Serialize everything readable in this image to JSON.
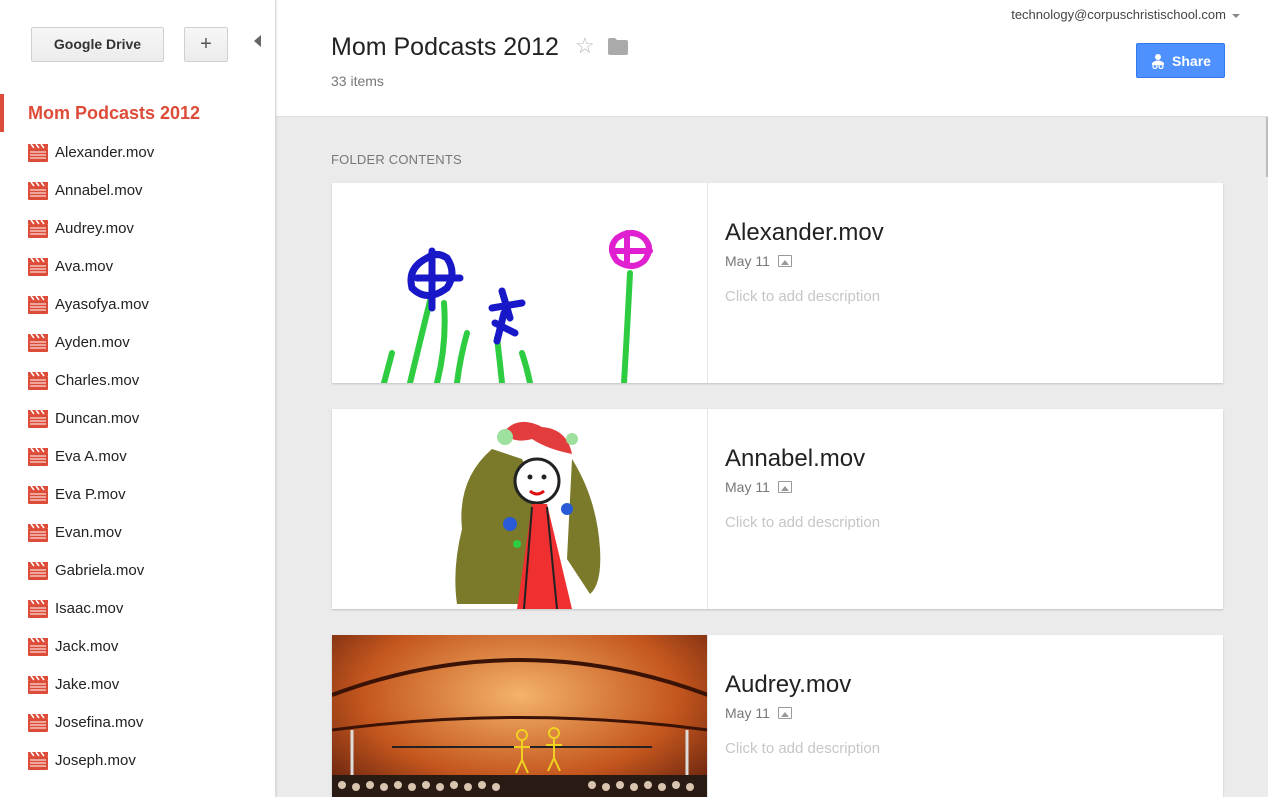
{
  "sidebar": {
    "drive_button": "Google Drive",
    "new_button": "+",
    "current_folder": "Mom Podcasts 2012",
    "files": [
      "Alexander.mov",
      "Annabel.mov",
      "Audrey.mov",
      "Ava.mov",
      "Ayasofya.mov",
      "Ayden.mov",
      "Charles.mov",
      "Duncan.mov",
      "Eva A.mov",
      "Eva P.mov",
      "Evan.mov",
      "Gabriela.mov",
      "Isaac.mov",
      "Jack.mov",
      "Jake.mov",
      "Josefina.mov",
      "Joseph.mov"
    ]
  },
  "header": {
    "title": "Mom Podcasts 2012",
    "item_count": "33 items",
    "account": "technology@corpuschristischool.com",
    "share_label": "Share"
  },
  "main": {
    "section_label": "FOLDER CONTENTS",
    "cards": [
      {
        "title": "Alexander.mov",
        "date": "May 11",
        "description": "Click to add description",
        "thumb": "flowers-drawing"
      },
      {
        "title": "Annabel.mov",
        "date": "May 11",
        "description": "Click to add description",
        "thumb": "portrait-drawing"
      },
      {
        "title": "Audrey.mov",
        "date": "May 11",
        "description": "Click to add description",
        "thumb": "circus-drawing"
      }
    ]
  },
  "colors": {
    "accent_red": "#dd4b39",
    "share_blue": "#4d90fe",
    "background": "#ebebeb"
  },
  "icons": {
    "file": "video-clapper-icon",
    "star": "star-outline-icon",
    "folder": "folder-icon",
    "share": "people-icon",
    "meta": "image-icon"
  }
}
